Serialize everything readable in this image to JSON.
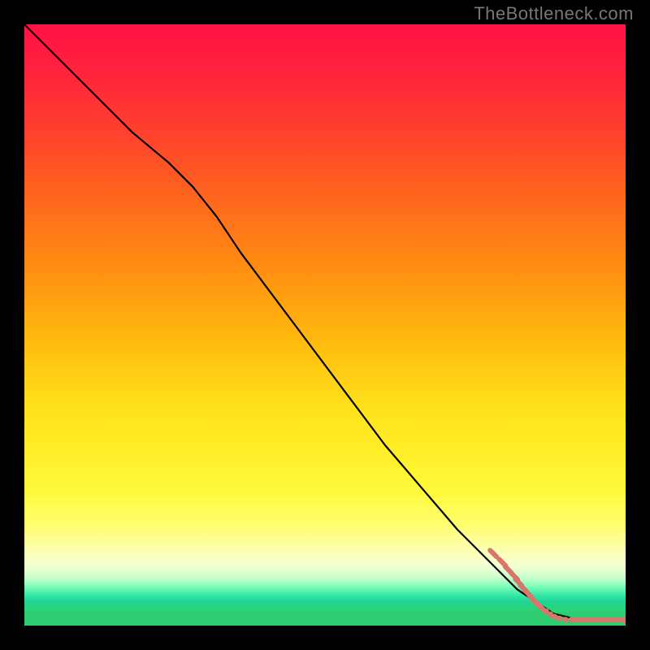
{
  "watermark": "TheBottleneck.com",
  "chart_data": {
    "type": "line",
    "title": "",
    "xlabel": "",
    "ylabel": "",
    "xlim": [
      0,
      100
    ],
    "ylim": [
      0,
      100
    ],
    "grid": false,
    "legend": false,
    "series": [
      {
        "name": "bottleneck-curve",
        "x": [
          0,
          6,
          12,
          18,
          24,
          28,
          32,
          36,
          42,
          48,
          54,
          60,
          66,
          72,
          78,
          82,
          85,
          88,
          92,
          96,
          100
        ],
        "y": [
          100,
          94,
          88,
          82,
          77,
          73,
          68,
          62,
          54,
          46,
          38,
          30,
          23,
          16,
          10,
          6,
          4,
          2,
          1,
          1,
          1
        ]
      }
    ],
    "markers": {
      "name": "data-points",
      "color": "#d8766a",
      "points": [
        {
          "x": 78,
          "y": 12
        },
        {
          "x": 79.5,
          "y": 10.5
        },
        {
          "x": 80.5,
          "y": 9.3
        },
        {
          "x": 81.5,
          "y": 8.2
        },
        {
          "x": 82.2,
          "y": 7.2
        },
        {
          "x": 83,
          "y": 6.2
        },
        {
          "x": 83.8,
          "y": 5.3
        },
        {
          "x": 84.5,
          "y": 4.5
        },
        {
          "x": 85.2,
          "y": 3.7
        },
        {
          "x": 86,
          "y": 3
        },
        {
          "x": 86.8,
          "y": 2.4
        },
        {
          "x": 87.5,
          "y": 1.9
        },
        {
          "x": 88.2,
          "y": 1.5
        },
        {
          "x": 89,
          "y": 1.2
        },
        {
          "x": 90,
          "y": 1
        },
        {
          "x": 91,
          "y": 1
        },
        {
          "x": 92.2,
          "y": 1
        },
        {
          "x": 93.5,
          "y": 1
        },
        {
          "x": 95,
          "y": 1
        },
        {
          "x": 96.5,
          "y": 1
        },
        {
          "x": 98,
          "y": 1
        },
        {
          "x": 100,
          "y": 1
        }
      ]
    },
    "background_gradient": {
      "orientation": "vertical",
      "stops": [
        {
          "pos": 0,
          "color": "#ff1244"
        },
        {
          "pos": 0.3,
          "color": "#ff6a1c"
        },
        {
          "pos": 0.64,
          "color": "#ffe21a"
        },
        {
          "pos": 0.88,
          "color": "#fcffb2"
        },
        {
          "pos": 0.94,
          "color": "#32e6a6"
        },
        {
          "pos": 1.0,
          "color": "#2ecc71"
        }
      ]
    }
  }
}
